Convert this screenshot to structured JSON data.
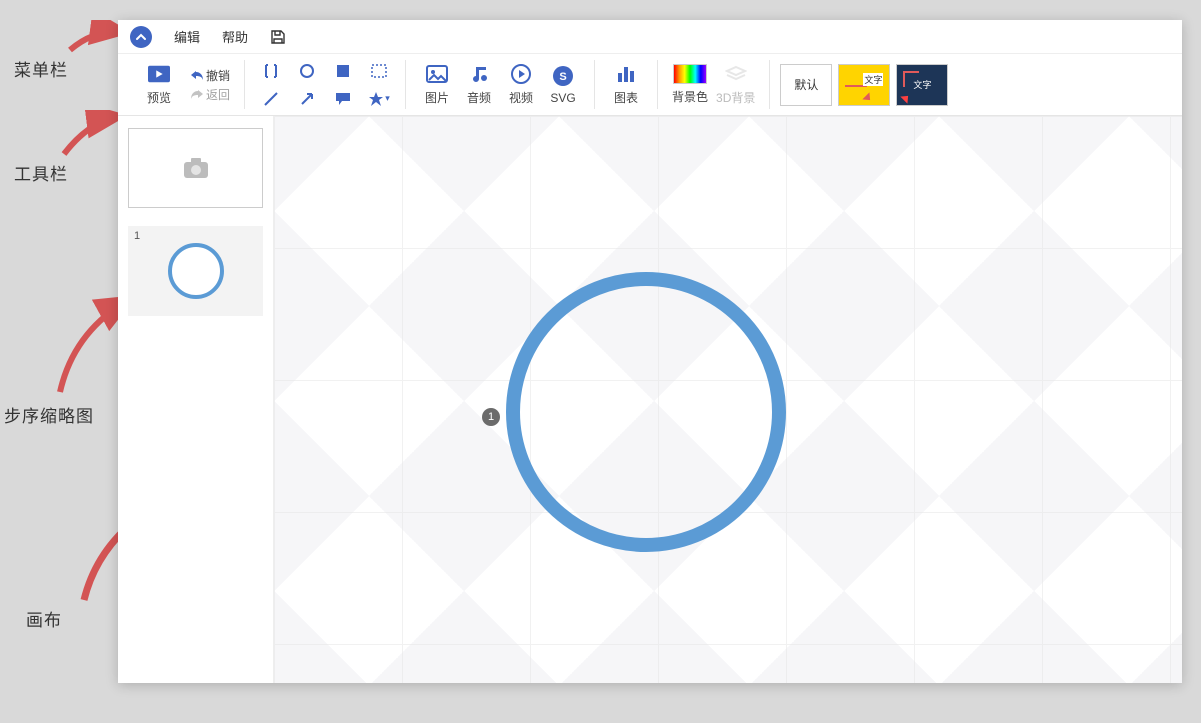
{
  "menubar": {
    "edit": "编辑",
    "help": "帮助"
  },
  "toolbar": {
    "preview": "预览",
    "undo": "撤销",
    "back": "返回",
    "image": "图片",
    "audio": "音频",
    "video": "视频",
    "svg": "SVG",
    "chart": "图表",
    "bgcolor": "背景色",
    "bg3d": "3D背景",
    "default_template": "默认"
  },
  "templates": {
    "yellow_label": "文字",
    "dark_label": "文字"
  },
  "sidebar": {
    "step1_num": "1"
  },
  "canvas": {
    "marker": "1"
  },
  "annotations": {
    "menubar": "菜单栏",
    "toolbar": "工具栏",
    "thumbnails": "步序缩略图",
    "canvas": "画布"
  }
}
